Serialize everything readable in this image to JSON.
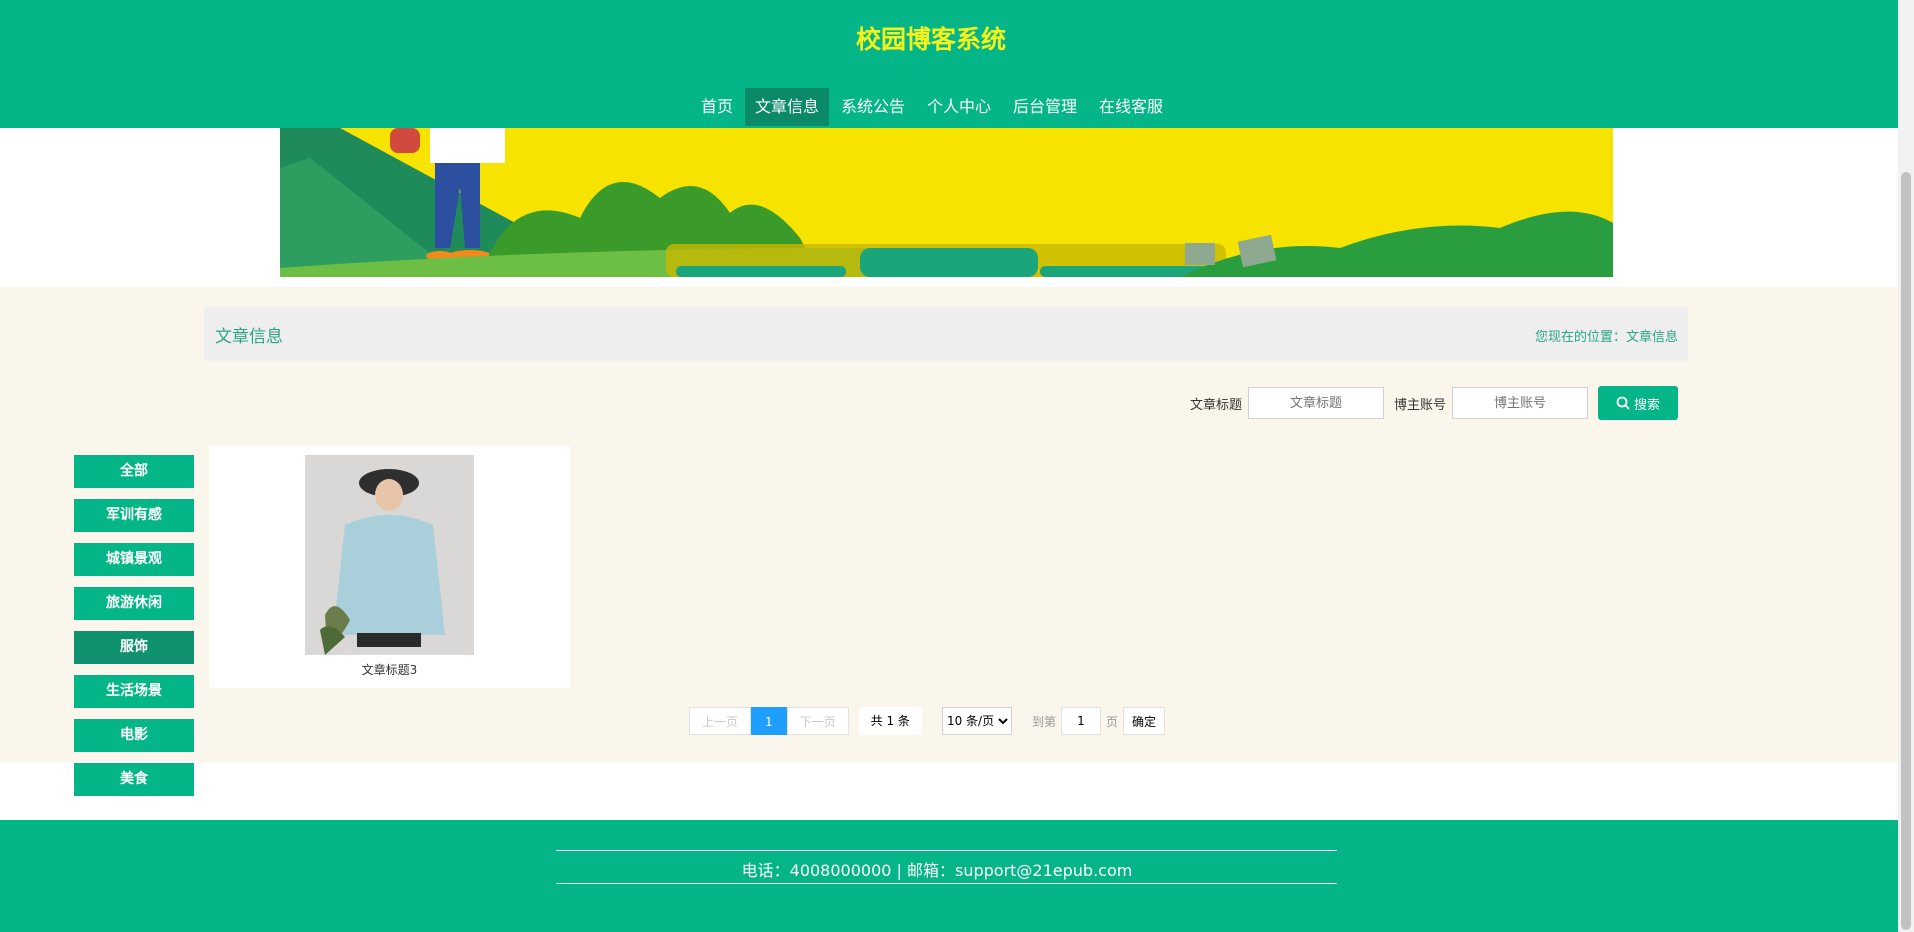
{
  "header": {
    "title": "校园博客系统",
    "nav": [
      "首页",
      "文章信息",
      "系统公告",
      "个人中心",
      "后台管理",
      "在线客服"
    ],
    "active_nav": "文章信息"
  },
  "breadcrumb": {
    "title": "文章信息",
    "location_label": "您现在的位置：",
    "location_value": "文章信息"
  },
  "search": {
    "title_label": "文章标题",
    "title_placeholder": "文章标题",
    "account_label": "博主账号",
    "account_placeholder": "博主账号",
    "button_label": "搜索"
  },
  "categories": [
    "全部",
    "军训有感",
    "城镇景观",
    "旅游休闲",
    "服饰",
    "生活场景",
    "电影",
    "美食"
  ],
  "active_category": "服饰",
  "articles": [
    {
      "title": "文章标题3"
    }
  ],
  "pagination": {
    "prev": "上一页",
    "current": "1",
    "next": "下一页",
    "total": "共 1 条",
    "page_size": "10 条/页",
    "goto_label": "到第",
    "goto_value": "1",
    "page_unit": "页",
    "confirm": "确定"
  },
  "footer": {
    "text": "电话：4008000000 | 邮箱：support@21epub.com"
  },
  "colors": {
    "primary": "#04b687",
    "title_yellow": "#f4f21c",
    "page_bg": "#faf6ec",
    "pager_active": "#1e9fff"
  }
}
